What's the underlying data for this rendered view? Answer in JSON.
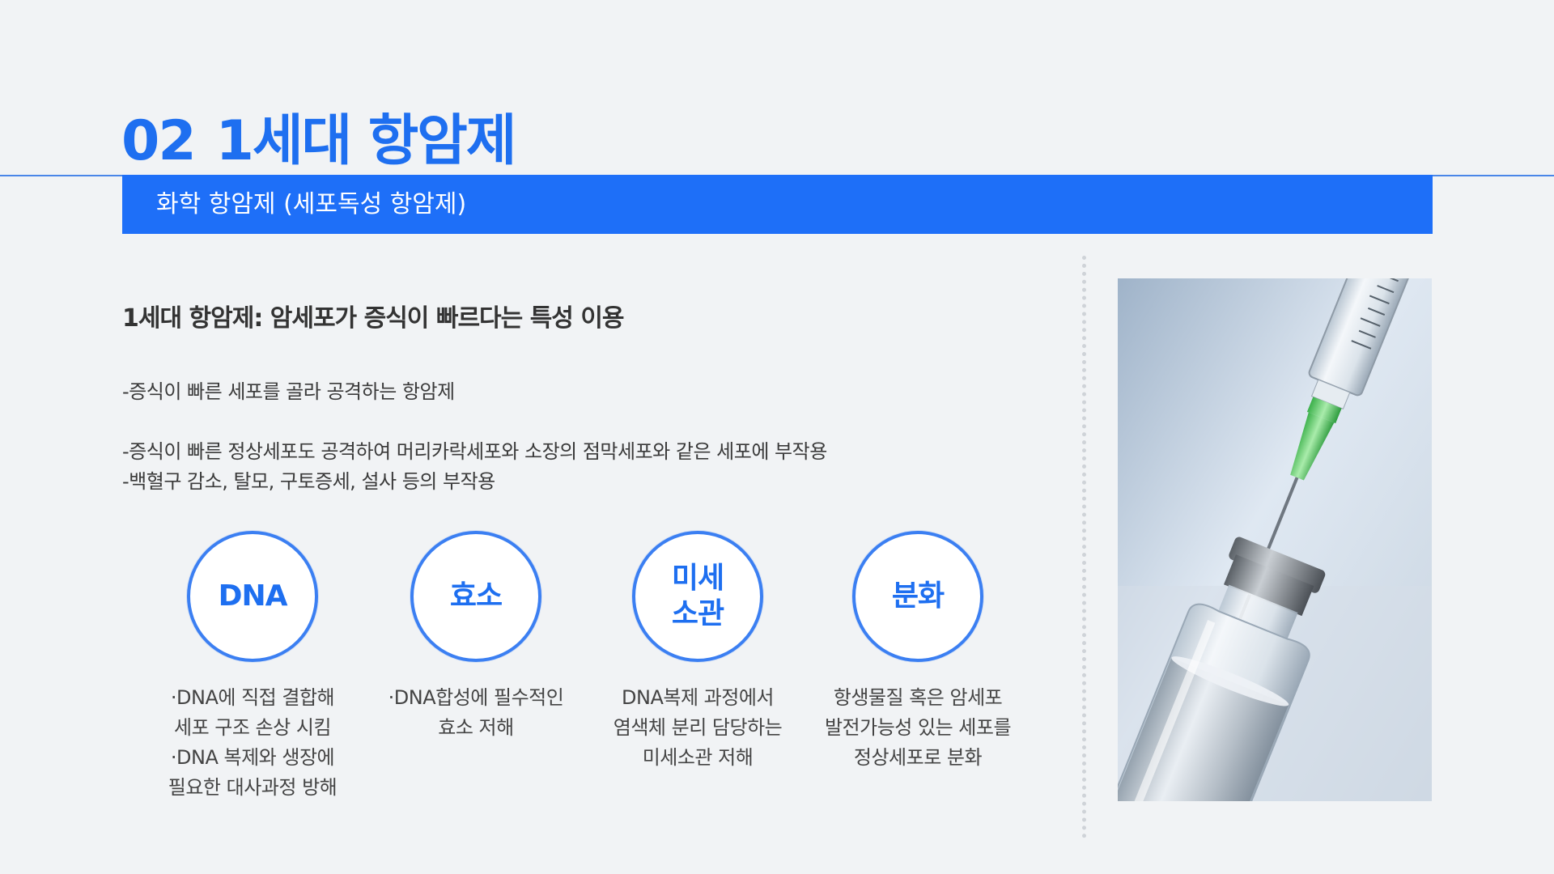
{
  "title": {
    "number": "02",
    "text": "1세대 항암제"
  },
  "section": {
    "label": "화학 항암제 (세포독성 항암제)"
  },
  "heading": "1세대 항암제: 암세포가 증식이 빠르다는 특성 이용",
  "bullets": [
    "-증식이 빠른 세포를 골라 공격하는 항암제",
    "-증식이 빠른 정상세포도 공격하여 머리카락세포와 소장의 점막세포와 같은 세포에 부작용",
    "-백혈구 감소, 탈모, 구토증세, 설사 등의 부작용"
  ],
  "targets": [
    {
      "label": "DNA",
      "caption": "·DNA에 직접 결합해\n세포 구조 손상 시킴\n·DNA 복제와 생장에\n필요한 대사과정 방해"
    },
    {
      "label": "효소",
      "caption": "·DNA합성에 필수적인\n효소 저해"
    },
    {
      "label": "미세\n소관",
      "caption": "DNA복제 과정에서\n염색체 분리 담당하는\n미세소관 저해"
    },
    {
      "label": "분화",
      "caption": "항생물질 혹은  암세포\n발전가능성 있는 세포를\n정상세포로 분화"
    }
  ],
  "colors": {
    "accent": "#1e6ff8",
    "background": "#f1f3f5",
    "circle_border": "#3b7ff2"
  },
  "image": {
    "icon": "syringe-vial-photo"
  }
}
